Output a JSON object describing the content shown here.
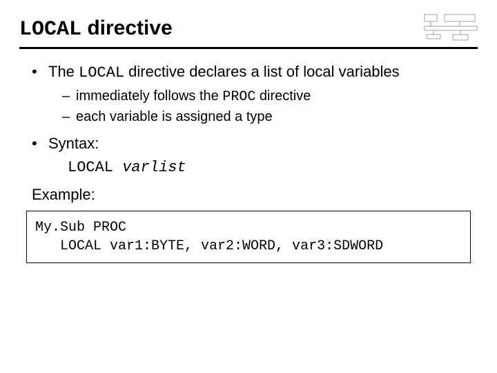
{
  "title": {
    "keyword": "LOCAL",
    "rest": " directive"
  },
  "bullets": [
    {
      "pre": "The ",
      "kw": "LOCAL",
      "post": " directive declares a list of local variables",
      "subs": [
        {
          "pre": "immediately follows the ",
          "kw": "PROC",
          "post": " directive"
        },
        {
          "pre": "each variable is assigned a type",
          "kw": "",
          "post": ""
        }
      ]
    },
    {
      "pre": "Syntax:",
      "kw": "",
      "post": ""
    }
  ],
  "syntax": {
    "keyword": "LOCAL ",
    "varlist": "varlist"
  },
  "example_label": "Example:",
  "code": "My.Sub PROC\n   LOCAL var1:BYTE, var2:WORD, var3:SDWORD"
}
